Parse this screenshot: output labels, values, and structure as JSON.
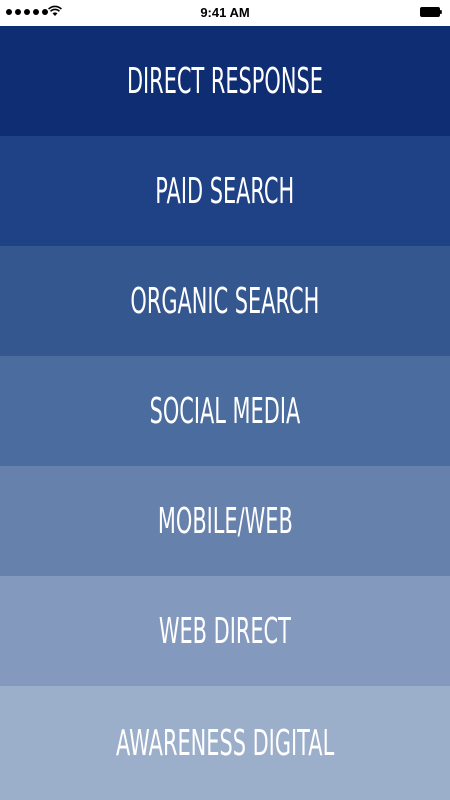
{
  "status_bar": {
    "time": "9:41 AM",
    "signal_icon": "signal-dots-icon",
    "wifi_icon": "wifi-icon",
    "battery_icon": "battery-icon"
  },
  "menu": {
    "items": [
      {
        "label": "DIRECT RESPONSE",
        "color": "#0f2d73"
      },
      {
        "label": "PAID SEARCH",
        "color": "#1f4185"
      },
      {
        "label": "ORGANIC SEARCH",
        "color": "#355790"
      },
      {
        "label": "SOCIAL MEDIA",
        "color": "#4b6c9e"
      },
      {
        "label": "MOBILE/WEB",
        "color": "#6781ad"
      },
      {
        "label": "WEB DIRECT",
        "color": "#8399be"
      },
      {
        "label": "AWARENESS DIGITAL",
        "color": "#9cafca"
      }
    ]
  }
}
